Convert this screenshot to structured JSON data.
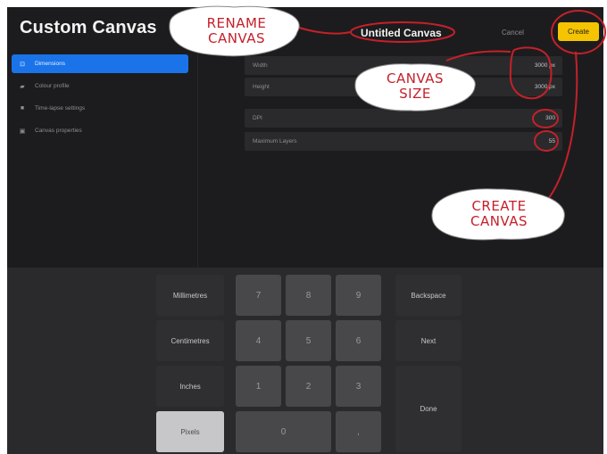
{
  "header": {
    "title": "Custom Canvas",
    "canvas_name": "Untitled Canvas",
    "cancel_label": "Cancel",
    "create_label": "Create"
  },
  "sidebar": {
    "items": [
      {
        "label": "Dimensions",
        "icon": "dimensions-icon",
        "active": true
      },
      {
        "label": "Colour profile",
        "icon": "colour-profile-icon",
        "active": false
      },
      {
        "label": "Time-lapse settings",
        "icon": "video-camera-icon",
        "active": false
      },
      {
        "label": "Canvas properties",
        "icon": "canvas-properties-icon",
        "active": false
      }
    ]
  },
  "settings": {
    "width_label": "Width",
    "width_value": "3000 px",
    "height_label": "Height",
    "height_value": "3000 px",
    "dpi_label": "DPI",
    "dpi_value": "300",
    "layers_label": "Maximum Layers",
    "layers_value": "55"
  },
  "keypad": {
    "units": [
      "Millimetres",
      "Centimetres",
      "Inches",
      "Pixels"
    ],
    "selected_unit": "Pixels",
    "digits": [
      "7",
      "8",
      "9",
      "4",
      "5",
      "6",
      "1",
      "2",
      "3"
    ],
    "zero": "0",
    "comma": ",",
    "backspace_label": "Backspace",
    "next_label": "Next",
    "done_label": "Done"
  },
  "annotations": {
    "rename_line1": "RENAME",
    "rename_line2": "CANVAS",
    "size_line1": "CANVAS",
    "size_line2": "SIZE",
    "create_line1": "CREATE",
    "create_line2": "CANVAS",
    "color": "#c5202a"
  },
  "colors": {
    "accent_blue": "#1a73e8",
    "create_yellow": "#f5c400",
    "background": "#1c1c1e"
  }
}
